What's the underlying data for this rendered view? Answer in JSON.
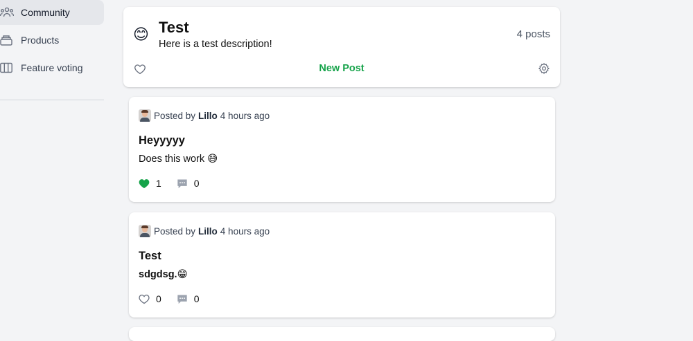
{
  "sidebar": {
    "items": [
      {
        "label": "Community",
        "icon": "users-icon",
        "active": true
      },
      {
        "label": "Products",
        "icon": "stack-icon",
        "active": false
      },
      {
        "label": "Feature voting",
        "icon": "columns-icon",
        "active": false
      }
    ]
  },
  "community": {
    "emoji": "😊",
    "title": "Test",
    "description": "Here is a test description!",
    "post_count": "4 posts",
    "new_post_label": "New Post"
  },
  "posts": [
    {
      "posted_by": "Posted by",
      "author": "Lillo",
      "time": "4 hours ago",
      "title": "Heyyyyy",
      "body": "Does this work 😅",
      "likes": "1",
      "liked": true,
      "comments": "0"
    },
    {
      "posted_by": "Posted by",
      "author": "Lillo",
      "time": "4 hours ago",
      "title": "Test",
      "body": "sdgdsg.😁",
      "likes": "0",
      "liked": false,
      "comments": "0"
    }
  ],
  "colors": {
    "accent": "#16a34a",
    "background": "#f3f4f6",
    "card": "#ffffff",
    "muted_icon": "#9ca3af"
  }
}
